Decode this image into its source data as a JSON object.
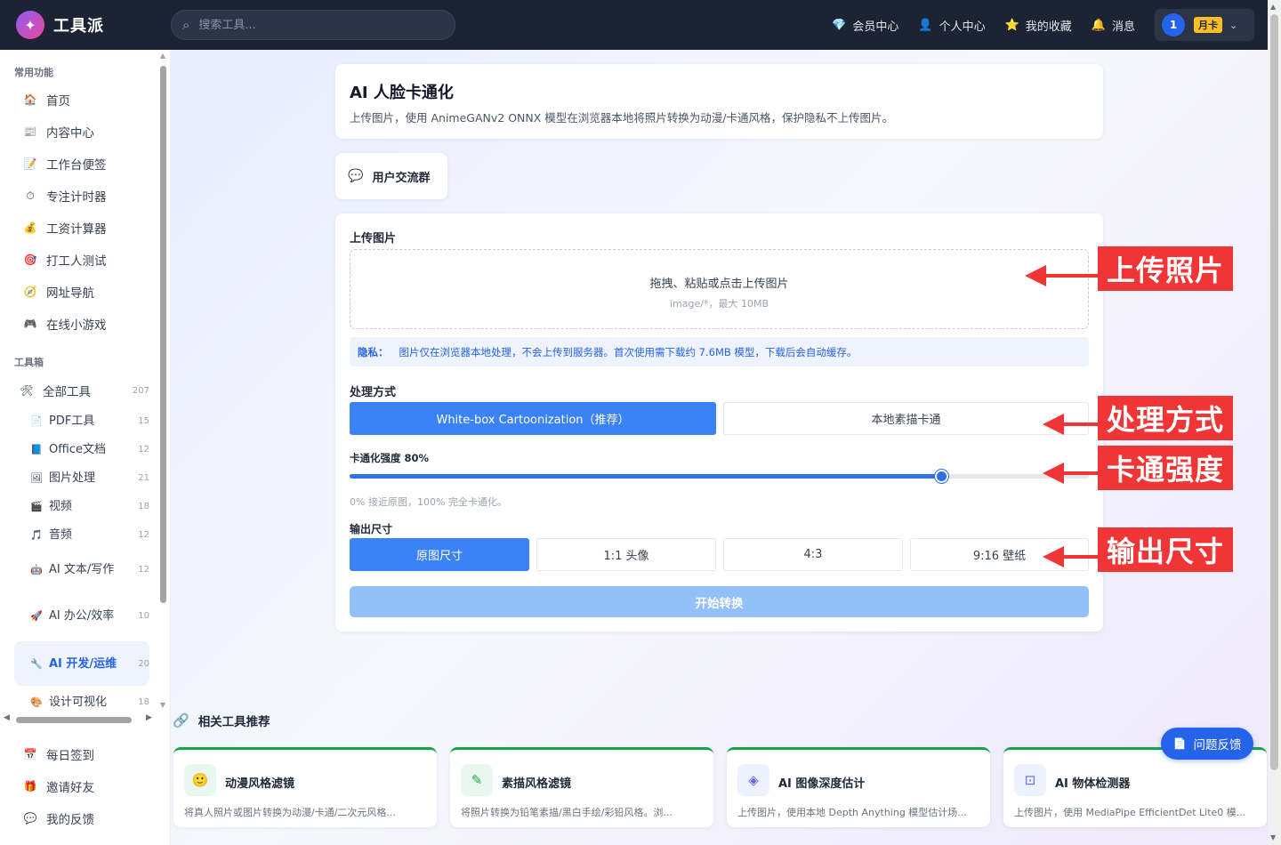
{
  "brand": {
    "name": "工具派"
  },
  "search": {
    "placeholder": "搜索工具..."
  },
  "nav": [
    {
      "icon": "💎",
      "icon_name": "diamond-icon",
      "label": "会员中心"
    },
    {
      "icon": "👤",
      "icon_name": "user-icon",
      "label": "个人中心"
    },
    {
      "icon": "⭐",
      "icon_name": "star-icon",
      "label": "我的收藏"
    },
    {
      "icon": "🔔",
      "icon_name": "bell-icon",
      "label": "消息"
    }
  ],
  "user": {
    "avatar_text": "1",
    "badge": "月卡"
  },
  "sidebar": {
    "common_title": "常用功能",
    "common": [
      {
        "icon": "🏠",
        "label": "首页"
      },
      {
        "icon": "📰",
        "label": "内容中心"
      },
      {
        "icon": "📝",
        "label": "工作台便签"
      },
      {
        "icon": "⏱",
        "label": "专注计时器"
      },
      {
        "icon": "💰",
        "label": "工资计算器"
      },
      {
        "icon": "🎯",
        "label": "打工人测试"
      },
      {
        "icon": "🧭",
        "label": "网址导航"
      },
      {
        "icon": "🎮",
        "label": "在线小游戏"
      }
    ],
    "toolbox_title": "工具箱",
    "all_tools": {
      "icon": "🛠",
      "label": "全部工具",
      "count": "207"
    },
    "categories": [
      {
        "icon": "📄",
        "label": "PDF工具",
        "count": "15"
      },
      {
        "icon": "📘",
        "label": "Office文档",
        "count": "12"
      },
      {
        "icon": "🖼",
        "label": "图片处理",
        "count": "21"
      },
      {
        "icon": "🎬",
        "label": "视频",
        "count": "18"
      },
      {
        "icon": "🎵",
        "label": "音频",
        "count": "12"
      },
      {
        "icon": "🤖",
        "label": "AI 文本/写作",
        "count": "12"
      },
      {
        "icon": "🚀",
        "label": "AI 办公/效率",
        "count": "10"
      },
      {
        "icon": "🔧",
        "label": "AI 开发/运维",
        "count": "20"
      },
      {
        "icon": "🎨",
        "label": "设计可视化",
        "count": "18"
      }
    ],
    "bottom": [
      {
        "icon": "📅",
        "label": "每日签到"
      },
      {
        "icon": "🎁",
        "label": "邀请好友"
      },
      {
        "icon": "💬",
        "label": "我的反馈"
      }
    ]
  },
  "page": {
    "title": "AI 人脸卡通化",
    "desc": "上传图片，使用 AnimeGANv2 ONNX 模型在浏览器本地将照片转换为动漫/卡通风格，保护隐私不上传图片。"
  },
  "group": {
    "icon": "💬",
    "label": "用户交流群"
  },
  "upload": {
    "label": "上传图片",
    "main": "拖拽、粘贴或点击上传图片",
    "sub": "image/*，最大 10MB"
  },
  "privacy": {
    "title": "隐私：",
    "text": "图片仅在浏览器本地处理，不会上传到服务器。首次使用需下载约 7.6MB 模型，下载后会自动缓存。"
  },
  "method": {
    "label": "处理方式",
    "options": [
      "White-box Cartoonization（推荐）",
      "本地素描卡通"
    ],
    "selected": 0
  },
  "strength": {
    "label": "卡通化强度 80%",
    "value": 80,
    "hint": "0% 接近原图，100% 完全卡通化。"
  },
  "output": {
    "label": "输出尺寸",
    "options": [
      "原图尺寸",
      "1:1 头像",
      "4:3",
      "9:16 壁纸"
    ],
    "selected": 0
  },
  "start_label": "开始转换",
  "annotations": [
    "上传照片",
    "处理方式",
    "卡通强度",
    "输出尺寸"
  ],
  "related": {
    "title": "相关工具推荐",
    "items": [
      {
        "icon": "🙂",
        "name": "动漫风格滤镜",
        "desc": "将真人照片或图片转换为动漫/卡通/二次元风格..."
      },
      {
        "icon": "✎",
        "name": "素描风格滤镜",
        "desc": "将照片转换为铅笔素描/黑白手绘/彩铅风格。浏..."
      },
      {
        "icon": "◈",
        "name": "AI 图像深度估计",
        "desc": "上传图片，使用本地 Depth Anything 模型估计场..."
      },
      {
        "icon": "⊡",
        "name": "AI 物体检测器",
        "desc": "上传图片，使用 MediaPipe EfficientDet Lite0 模..."
      }
    ]
  },
  "feedback": {
    "icon": "📄",
    "label": "问题反馈"
  }
}
